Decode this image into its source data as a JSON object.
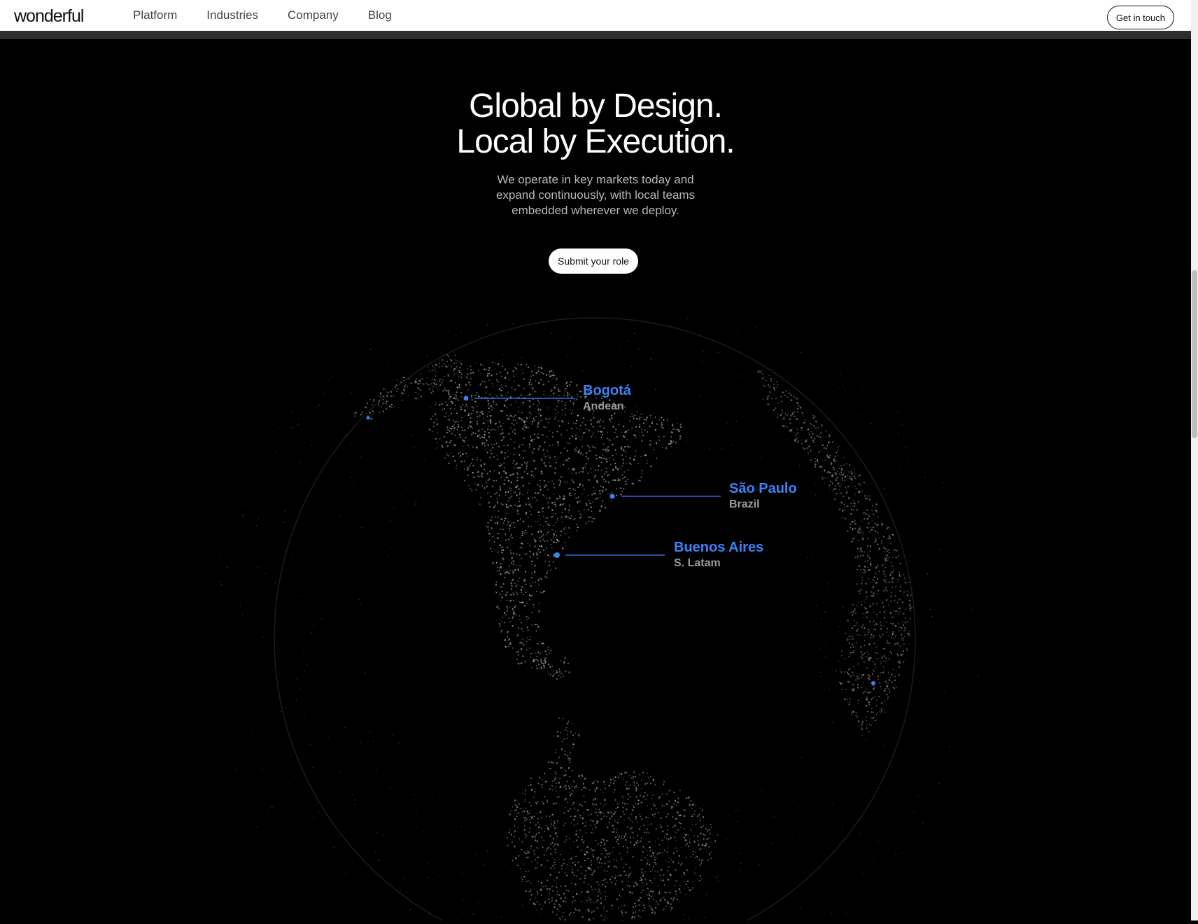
{
  "header": {
    "logo": "wonderful",
    "nav": [
      "Platform",
      "Industries",
      "Company",
      "Blog"
    ],
    "cta_label": "Get in touch"
  },
  "hero": {
    "title_lines": [
      "Global by Design.",
      "Local by Execution."
    ],
    "subtitle_lines": [
      "We operate in key markets today and",
      "expand continuously, with local teams",
      "embedded wherever we deploy."
    ],
    "button_label": "Submit your role"
  },
  "locations": [
    {
      "city": "Bogotá",
      "region": "Andean"
    },
    {
      "city": "São Paulo",
      "region": "Brazil"
    },
    {
      "city": "Buenos Aires",
      "region": "S. Latam"
    }
  ],
  "colors": {
    "background": "#000000",
    "accent": "#3b82f6",
    "dots": "#9a9a9a",
    "region_text": "#9a9a9a"
  }
}
